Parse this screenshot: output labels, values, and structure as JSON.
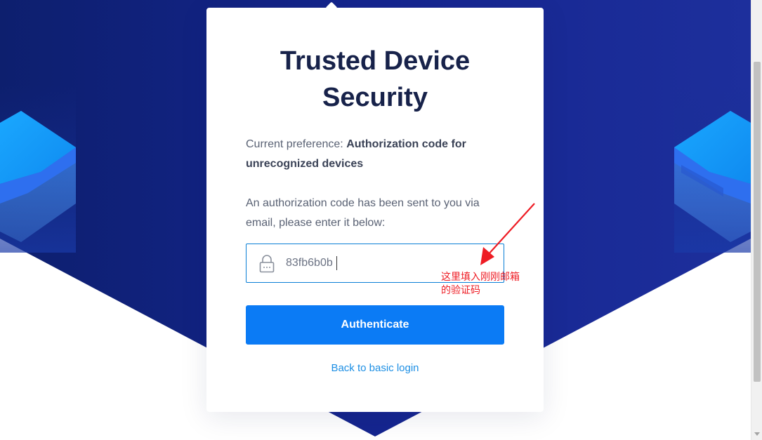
{
  "card": {
    "title_line1": "Trusted Device",
    "title_line2": "Security",
    "preference_prefix": "Current preference: ",
    "preference_value": "Authorization code for unrecognized devices",
    "message": "An authorization code has been sent to you via email, please enter it below:",
    "code_input": {
      "value": "83fb6b0b",
      "icon": "lock-icon"
    },
    "submit_label": "Authenticate",
    "back_link_label": "Back to basic login"
  },
  "annotation": {
    "line1": "这里填入刚刚邮箱",
    "line2": "的验证码",
    "color": "#ee1c24"
  },
  "colors": {
    "background_dark": "#1a2a8c",
    "accent_blue": "#0b7bf5",
    "link_blue": "#1d8fe4",
    "title_navy": "#17224a"
  }
}
